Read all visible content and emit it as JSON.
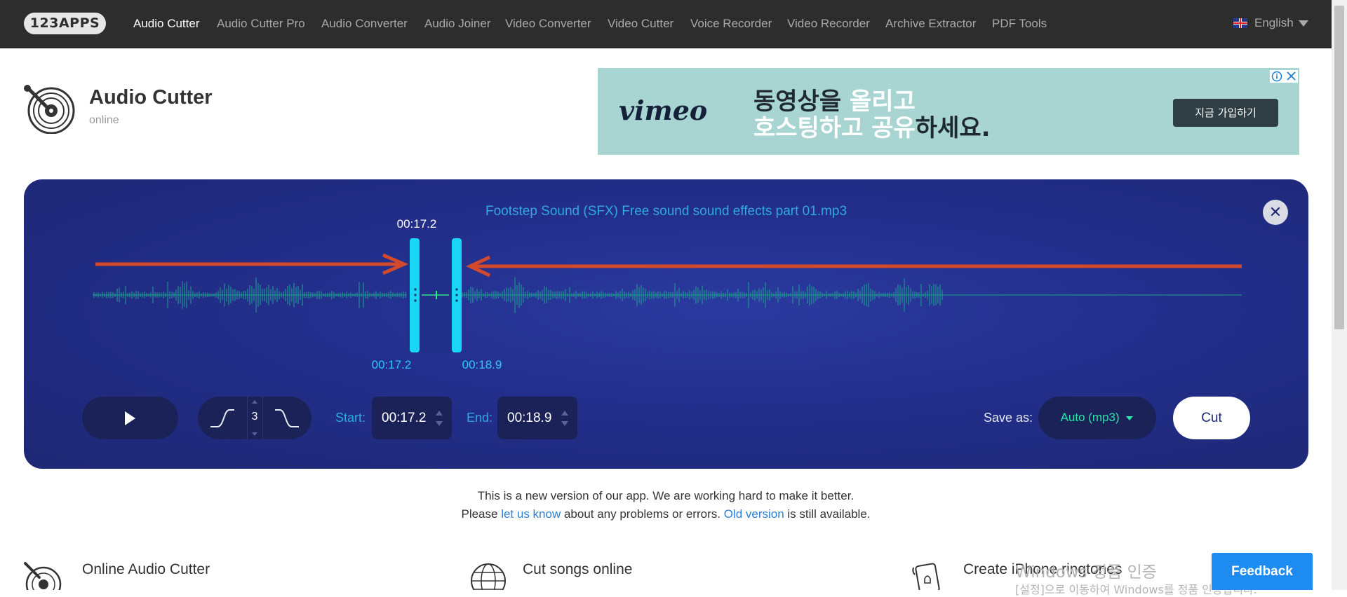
{
  "nav": {
    "logo": "123APPS",
    "items": [
      {
        "label": "Audio Cutter",
        "active": true
      },
      {
        "label": "Audio Cutter Pro"
      },
      {
        "label": "Audio Converter"
      },
      {
        "label": "Audio Joiner"
      },
      {
        "label": "Video Converter"
      },
      {
        "label": "Video Cutter"
      },
      {
        "label": "Voice Recorder"
      },
      {
        "label": "Video Recorder"
      },
      {
        "label": "Archive Extractor"
      },
      {
        "label": "PDF Tools"
      }
    ],
    "language": "English"
  },
  "app": {
    "title": "Audio Cutter",
    "subtitle": "online"
  },
  "ad": {
    "brand": "vimeo",
    "line1_a": "동영상을 ",
    "line1_b": "올리고",
    "line2_a": "호스팅하고 공유",
    "line2_b": "하세요.",
    "cta": "지금 가입하기"
  },
  "editor": {
    "file_name": "Footstep Sound (SFX) Free sound sound effects part 01.mp3",
    "cursor_time": "00:17.2",
    "selection_start": "00:17.2",
    "selection_end": "00:18.9",
    "fade_value": "3",
    "start_label": "Start:",
    "start_value": "00:17.2",
    "end_label": "End:",
    "end_value": "00:18.9",
    "save_as_label": "Save as:",
    "format": "Auto (mp3)",
    "cut_label": "Cut",
    "colors": {
      "accent": "#2fa9df",
      "selection": "#19d6f5",
      "format": "#2ee4a6"
    }
  },
  "notice": {
    "line1": "This is a new version of our app. We are working hard to make it better.",
    "line2_a": "Please ",
    "link1": "let us know",
    "line2_b": " about any problems or errors. ",
    "link2": "Old version",
    "line2_c": " is still available."
  },
  "features": [
    {
      "title": "Online Audio Cutter"
    },
    {
      "title": "Cut songs online"
    },
    {
      "title": "Create iPhone ringtones"
    }
  ],
  "watermark": {
    "line1": "Windows 정품 인증",
    "line2": "[설정]으로 이동하여 Windows를 정품 인증합니다."
  },
  "feedback": "Feedback"
}
